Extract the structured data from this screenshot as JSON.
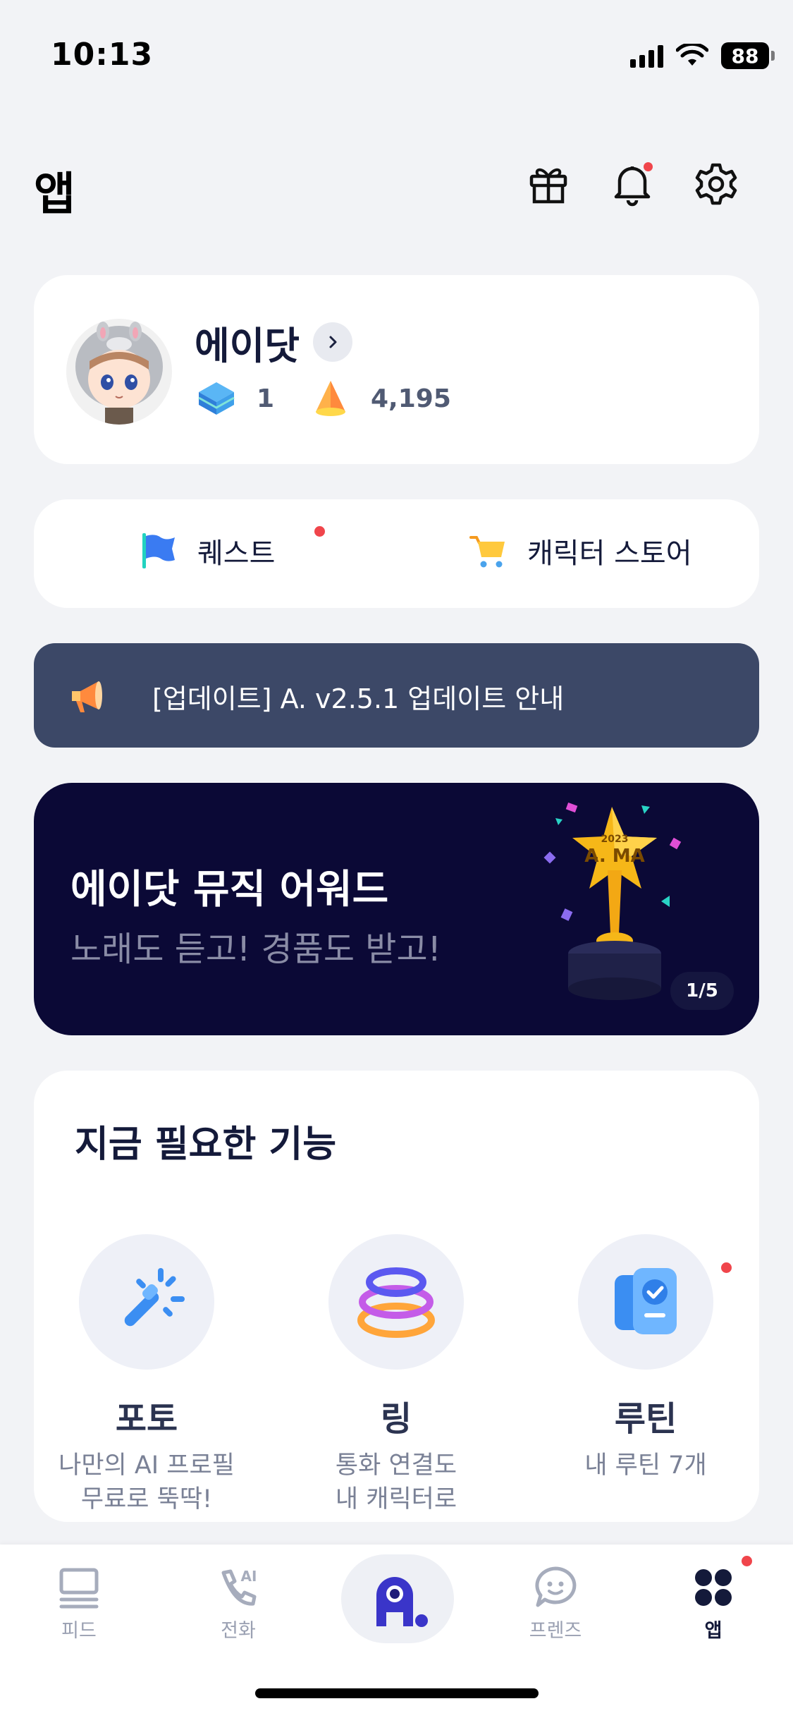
{
  "status_bar": {
    "time": "10:13",
    "battery": "88"
  },
  "header": {
    "title": "앱"
  },
  "profile": {
    "name": "에이닷",
    "gems": "1",
    "points": "4,195"
  },
  "shortcuts": {
    "quest": "퀘스트",
    "store": "캐릭터 스토어"
  },
  "notice": {
    "text": "[업데이트] A. v2.5.1 업데이트 안내"
  },
  "banner": {
    "title": "에이닷 뮤직 어워드",
    "subtitle": "노래도 듣고! 경품도 받고!",
    "page": "1/5",
    "trophy_label": "A. MA",
    "trophy_year": "2023"
  },
  "features": {
    "title": "지금 필요한 기능",
    "items": [
      {
        "name": "포토",
        "desc": "나만의 AI 프로필\n무료로 뚝딱!"
      },
      {
        "name": "링",
        "desc": "통화 연결도\n내 캐릭터로"
      },
      {
        "name": "루틴",
        "desc": "내 루틴 7개"
      }
    ]
  },
  "nav": {
    "feed": "피드",
    "call": "전화",
    "call_badge": "AI",
    "friends": "프렌즈",
    "apps": "앱"
  },
  "colors": {
    "accent_red": "#f0454b",
    "notice_bg": "#3c4867",
    "banner_bg": "#0b0936",
    "brand_blue": "#3a35c9"
  }
}
